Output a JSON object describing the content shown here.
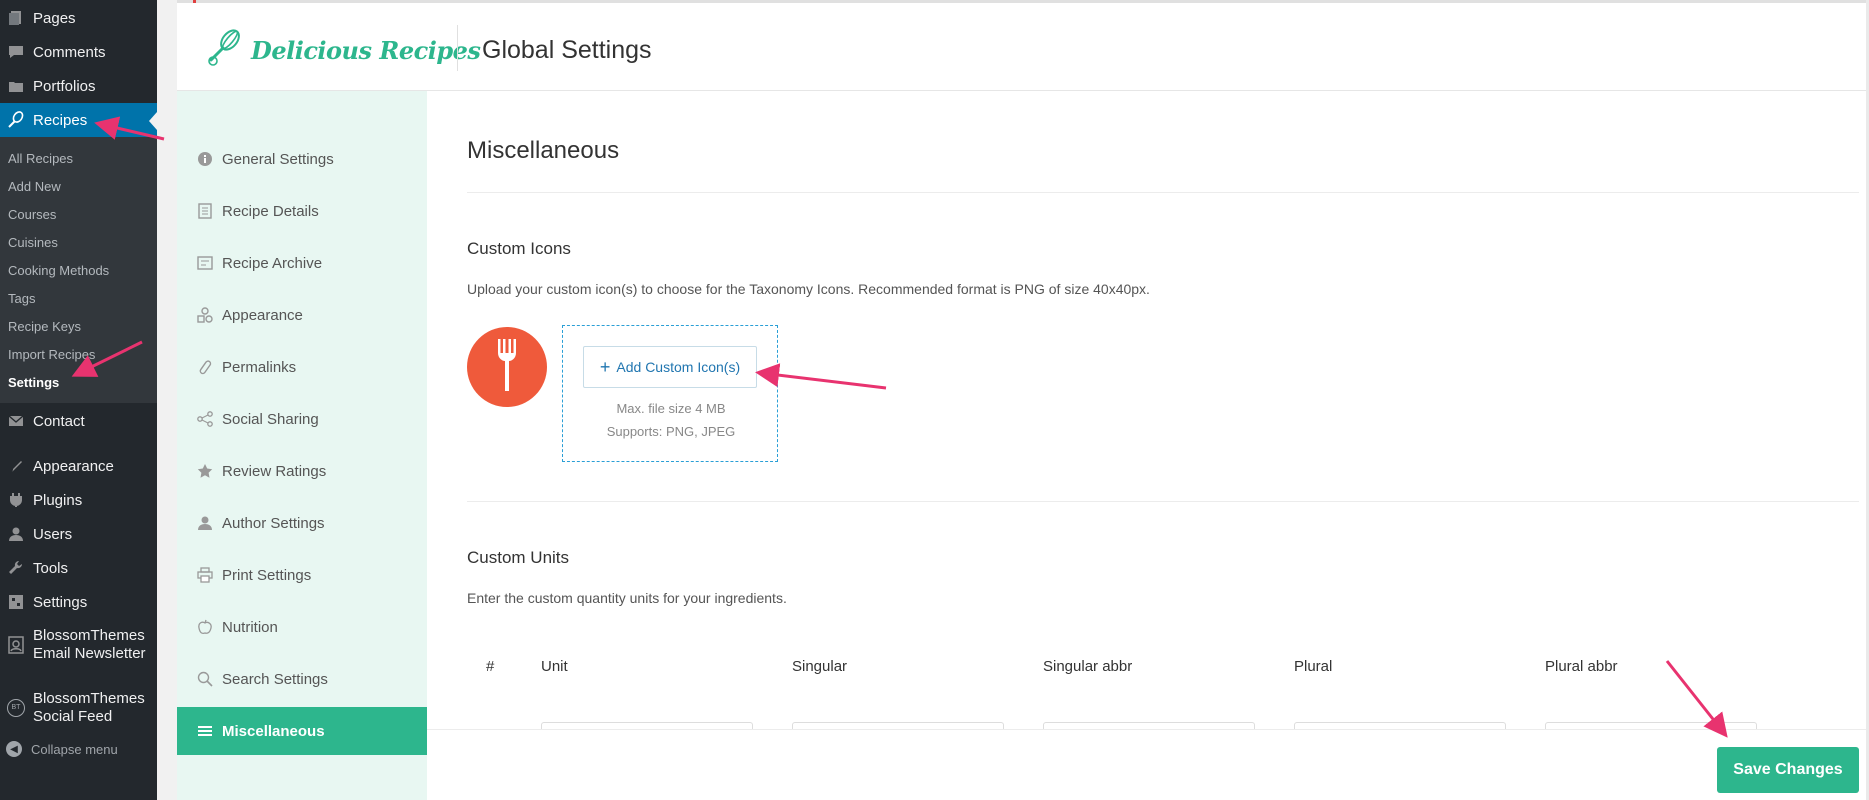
{
  "wp_menu": {
    "pages": "Pages",
    "comments": "Comments",
    "portfolios": "Portfolios",
    "recipes": "Recipes",
    "submenu": [
      "All Recipes",
      "Add New",
      "Courses",
      "Cuisines",
      "Cooking Methods",
      "Tags",
      "Recipe Keys",
      "Import Recipes",
      "Settings"
    ],
    "contact": "Contact",
    "appearance": "Appearance",
    "plugins": "Plugins",
    "users": "Users",
    "tools": "Tools",
    "settings": "Settings",
    "email_newsletter": [
      "BlossomThemes",
      "Email Newsletter"
    ],
    "social_feed": [
      "BlossomThemes",
      "Social Feed"
    ],
    "social_feed_badge": "BT",
    "collapse": "Collapse menu"
  },
  "header": {
    "logo_text": "Delicious Recipes",
    "title": "Global Settings"
  },
  "plugin_nav": {
    "items": [
      {
        "label": "General Settings",
        "icon": "info-icon"
      },
      {
        "label": "Recipe Details",
        "icon": "document-icon"
      },
      {
        "label": "Recipe Archive",
        "icon": "archive-icon"
      },
      {
        "label": "Appearance",
        "icon": "shapes-icon"
      },
      {
        "label": "Permalinks",
        "icon": "link-icon"
      },
      {
        "label": "Social Sharing",
        "icon": "share-icon"
      },
      {
        "label": "Review Ratings",
        "icon": "star-icon"
      },
      {
        "label": "Author Settings",
        "icon": "user-icon"
      },
      {
        "label": "Print Settings",
        "icon": "printer-icon"
      },
      {
        "label": "Nutrition",
        "icon": "apple-icon"
      },
      {
        "label": "Search Settings",
        "icon": "search-icon"
      },
      {
        "label": "Miscellaneous",
        "icon": "menu-icon"
      }
    ],
    "active_index": 11
  },
  "content": {
    "section_title": "Miscellaneous",
    "custom_icons": {
      "heading": "Custom Icons",
      "description": "Upload your custom icon(s) to choose for the Taxonomy Icons. Recommended format is PNG of size 40x40px.",
      "add_button": "Add Custom Icon(s)",
      "max_size": "Max. file size 4 MB",
      "supports": "Supports: PNG, JPEG"
    },
    "custom_units": {
      "heading": "Custom Units",
      "description": "Enter the custom quantity units for your ingredients.",
      "columns": [
        "#",
        "Unit",
        "Singular",
        "Singular abbr",
        "Plural",
        "Plural abbr"
      ]
    }
  },
  "footer": {
    "save_label": "Save Changes"
  },
  "colors": {
    "brand": "#2db68d",
    "wp_active": "#0073aa",
    "annotation_arrow": "#e8336f",
    "icon_circle": "#ef5a3b"
  }
}
